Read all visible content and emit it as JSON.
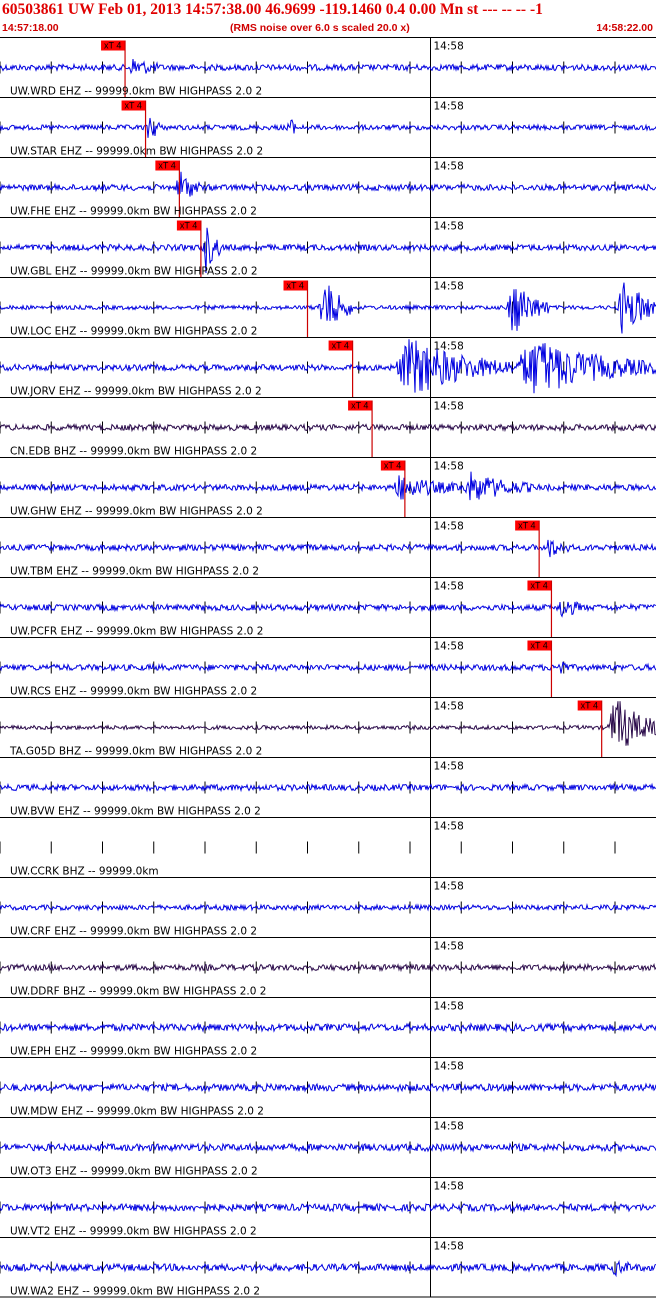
{
  "header": {
    "title": "60503861 UW Feb 01, 2013 14:57:38.00   46.9699 -119.1460  0.4 0.00 Mn st --- -- --  -1",
    "start_time": "14:57:18.00",
    "rms_note": "(RMS noise over 6.0 s scaled 20.0 x)",
    "end_time": "14:58:22.00"
  },
  "colors": {
    "title": "#e00000",
    "trace_blue": "#0000e0",
    "trace_dark": "#2a0a4a",
    "pick_box": "#ff0000",
    "pick_line": "#cc0000",
    "grid": "#000000"
  },
  "chart_data": {
    "type": "seismogram",
    "time_window": {
      "start": "14:57:18.00",
      "end": "14:58:22.00"
    },
    "minute_marker": "14:58",
    "tick_interval_seconds": 5,
    "channels": [
      {
        "label": "UW.WRD EHZ -- 99999.0km BW  HIGHPASS  2.0  2",
        "pick": "xT 4",
        "pick_offset_s": 12.2,
        "color": "blue",
        "amp": 3,
        "bursts": [
          [
            13.0,
            9,
            1.2
          ]
        ]
      },
      {
        "label": "UW.STAR EHZ -- 99999.0km BW  HIGHPASS  2.0  2",
        "pick": "xT 4",
        "pick_offset_s": 14.2,
        "color": "blue",
        "amp": 2.5,
        "bursts": [
          [
            14.5,
            16,
            0.6
          ],
          [
            28.0,
            13,
            0.4
          ]
        ]
      },
      {
        "label": "UW.FHE EHZ -- 99999.0km BW  HIGHPASS  2.0  2",
        "pick": "xT 4",
        "pick_offset_s": 17.5,
        "color": "blue",
        "amp": 3,
        "bursts": [
          [
            17.5,
            18,
            1.0
          ]
        ]
      },
      {
        "label": "UW.GBL EHZ -- 99999.0km BW  HIGHPASS  2.0  2",
        "pick": "xT 4",
        "pick_offset_s": 19.6,
        "color": "blue",
        "amp": 3,
        "bursts": [
          [
            20.0,
            25,
            0.8
          ]
        ]
      },
      {
        "label": "UW.LOC EHZ -- 99999.0km BW  HIGHPASS  2.0  2",
        "pick": "xT 4",
        "pick_offset_s": 30.0,
        "color": "blue",
        "amp": 2,
        "bursts": [
          [
            31.5,
            30,
            1.5
          ],
          [
            50.0,
            30,
            1.8
          ],
          [
            60.8,
            30,
            2.0
          ]
        ]
      },
      {
        "label": "UW.JORV EHZ -- 99999.0km BW  HIGHPASS  2.0  2",
        "pick": "xT 4",
        "pick_offset_s": 34.4,
        "color": "blue",
        "amp": 3,
        "bursts": [
          [
            40.0,
            30,
            5.0
          ],
          [
            52.0,
            30,
            6.0
          ]
        ]
      },
      {
        "label": "CN.EDB BHZ -- 99999.0km BW  HIGHPASS  2.0  2",
        "pick": "xT 4",
        "pick_offset_s": 36.3,
        "color": "dark",
        "amp": 3,
        "bursts": []
      },
      {
        "label": "UW.GHW EHZ -- 99999.0km BW  HIGHPASS  2.0  2",
        "pick": "xT 4",
        "pick_offset_s": 39.5,
        "color": "blue",
        "amp": 3,
        "bursts": [
          [
            39.0,
            11,
            3.0
          ],
          [
            46.0,
            14,
            3.0
          ]
        ]
      },
      {
        "label": "UW.TBM EHZ -- 99999.0km BW  HIGHPASS  2.0  2",
        "pick": "xT 4",
        "pick_offset_s": 52.6,
        "color": "blue",
        "amp": 3,
        "bursts": [
          [
            53.5,
            9,
            1.0
          ]
        ]
      },
      {
        "label": "UW.PCFR EHZ -- 99999.0km BW  HIGHPASS  2.0  2",
        "pick": "xT 4",
        "pick_offset_s": 53.8,
        "color": "blue",
        "amp": 3,
        "bursts": [
          [
            54.8,
            10,
            1.0
          ]
        ]
      },
      {
        "label": "UW.RCS EHZ -- 99999.0km BW  HIGHPASS  2.0  2",
        "pick": "xT 4",
        "pick_offset_s": 53.8,
        "color": "blue",
        "amp": 3,
        "bursts": [
          [
            54.6,
            10,
            0.4
          ]
        ]
      },
      {
        "label": "TA.G05D BHZ -- 99999.0km BW  HIGHPASS  2.0  2",
        "pick": "xT 4",
        "pick_offset_s": 58.7,
        "color": "dark",
        "amp": 2,
        "bursts": [
          [
            60.0,
            30,
            2.5
          ]
        ]
      },
      {
        "label": "UW.BVW EHZ -- 99999.0km BW  HIGHPASS  2.0  2",
        "pick": "",
        "pick_offset_s": null,
        "color": "blue",
        "amp": 3,
        "bursts": []
      },
      {
        "label": "UW.CCRK BHZ -- 99999.0km",
        "pick": "",
        "pick_offset_s": null,
        "color": "none",
        "amp": 0,
        "bursts": []
      },
      {
        "label": "UW.CRF EHZ -- 99999.0km BW  HIGHPASS  2.0  2",
        "pick": "",
        "pick_offset_s": null,
        "color": "blue",
        "amp": 2.5,
        "bursts": []
      },
      {
        "label": "UW.DDRF BHZ -- 99999.0km BW  HIGHPASS  2.0  2",
        "pick": "",
        "pick_offset_s": null,
        "color": "dark",
        "amp": 3,
        "bursts": []
      },
      {
        "label": "UW.EPH EHZ -- 99999.0km BW  HIGHPASS  2.0  2",
        "pick": "",
        "pick_offset_s": null,
        "color": "blue",
        "amp": 3.5,
        "bursts": []
      },
      {
        "label": "UW.MDW EHZ -- 99999.0km BW  HIGHPASS  2.0  2",
        "pick": "",
        "pick_offset_s": null,
        "color": "blue",
        "amp": 3.5,
        "bursts": []
      },
      {
        "label": "UW.OT3 EHZ -- 99999.0km BW  HIGHPASS  2.0  2",
        "pick": "",
        "pick_offset_s": null,
        "color": "blue",
        "amp": 3.5,
        "bursts": []
      },
      {
        "label": "UW.VT2 EHZ -- 99999.0km BW  HIGHPASS  2.0  2",
        "pick": "",
        "pick_offset_s": null,
        "color": "blue",
        "amp": 3.5,
        "bursts": []
      },
      {
        "label": "UW.WA2 EHZ -- 99999.0km BW  HIGHPASS  2.0  2",
        "pick": "",
        "pick_offset_s": null,
        "color": "blue",
        "amp": 3.5,
        "bursts": [
          [
            60.0,
            5,
            1.0
          ]
        ]
      }
    ]
  }
}
